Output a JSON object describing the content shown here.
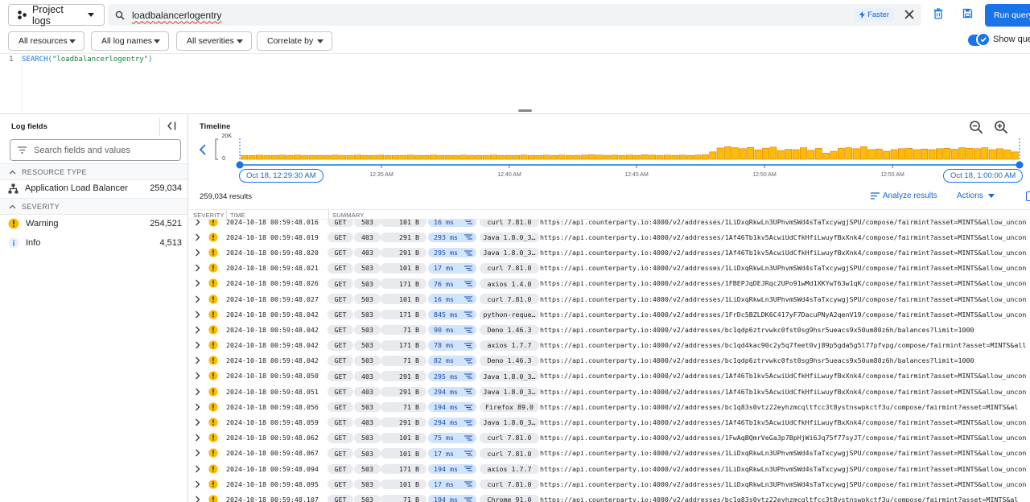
{
  "header": {
    "scope_label": "Project logs",
    "query_text": "loadbalancerlogentry",
    "faster_label": "Faster",
    "run_label": "Run query",
    "show_query_label": "Show query"
  },
  "filters": [
    {
      "label": "All resources"
    },
    {
      "label": "All log names"
    },
    {
      "label": "All severities"
    },
    {
      "label": "Correlate by"
    }
  ],
  "editor": {
    "line_number": "1",
    "fn": "SEARCH(",
    "arg": "\"loadbalancerlogentry\"",
    "close": ")"
  },
  "log_fields": {
    "title": "Log fields",
    "search_placeholder": "Search fields and values",
    "resource_type_header": "RESOURCE TYPE",
    "resource": {
      "name": "Application Load Balancer",
      "count": "259,034"
    },
    "severity_header": "SEVERITY",
    "severities": [
      {
        "name": "Warning",
        "count": "254,521"
      },
      {
        "name": "Info",
        "count": "4,513"
      }
    ]
  },
  "timeline": {
    "title": "Timeline",
    "y_max_label": "20K",
    "y_min_label": "0",
    "start_label": "Oct 18, 12:29:30 AM",
    "end_label": "Oct 18, 1:00:00 AM",
    "ticks": [
      "12:35 AM",
      "12:40 AM",
      "12:45 AM",
      "12:50 AM",
      "12:55 AM"
    ],
    "bars": [
      1.2,
      1.2,
      1.3,
      1.2,
      1.2,
      1.3,
      1.2,
      1.3,
      1.2,
      1.2,
      1.2,
      1.2,
      1.3,
      1.2,
      1.2,
      1.3,
      1.2,
      1.2,
      1.3,
      1.2,
      1.2,
      1.2,
      1.3,
      1.2,
      1.2,
      1.3,
      1.2,
      1.2,
      1.2,
      1.3,
      1.2,
      1.2,
      1.2,
      1.3,
      1.2,
      1.2,
      1.2,
      1.3,
      1.2,
      1.2,
      1.3,
      1.2,
      1.3,
      1.2,
      1.2,
      1.3,
      1.4,
      1.3,
      1.2,
      1.3,
      1.2,
      1.3,
      1.2,
      1.4,
      1.3,
      1.2,
      1.3,
      1.2,
      1.3,
      1.2,
      1.3,
      1.4,
      2.3,
      3.5,
      3.9,
      3.6,
      3.3,
      3.7,
      2.9,
      3.4,
      3.8,
      2.7,
      3.1,
      3.0,
      3.6,
      2.8,
      3.4,
      1.9,
      2.5,
      3.4,
      3.6,
      3.3,
      3.9,
      3.0,
      3.2,
      2.5,
      3.0,
      3.3,
      3.4,
      3.0,
      3.2,
      3.0,
      3.3,
      3.4,
      3.1,
      3.6,
      3.4,
      3.3,
      3.6,
      3.0,
      3.3,
      2.9,
      2.3
    ]
  },
  "results_count": "259,034 results",
  "analyze_label": "Analyze results",
  "actions_label": "Actions",
  "columns": {
    "severity": "SEVERITY",
    "time": "TIME",
    "summary": "SUMMARY"
  },
  "colors": {
    "accent": "#1a73e8",
    "warning": "#fbbc04",
    "bar_fill": "#fbbc04",
    "bar_stroke": "#e37400"
  },
  "rows": [
    {
      "time": "2024-10-18 00:59:48.016",
      "method": "GET",
      "status": "503",
      "size": "101 B",
      "latency": "16 ms",
      "agent": "curl 7.81.0",
      "url": "https://api.counterparty.io:4000/v2/addresses/1LiDxqRkwLn3UPhvmSWd4sTaTxcywgjSPU/compose/fairmint?asset=MINTS&allow_uncon"
    },
    {
      "time": "2024-10-18 00:59:48.019",
      "method": "GET",
      "status": "403",
      "size": "291 B",
      "latency": "293 ms",
      "agent": "Java 1.8.0_3…",
      "url": "https://api.counterparty.io:4000/v2/addresses/1Af46Tb1kv5AcwiUdCfkHfiLwuyfBxXnk4/compose/fairmint?asset=MINTS&allow_uncon"
    },
    {
      "time": "2024-10-18 00:59:48.020",
      "method": "GET",
      "status": "403",
      "size": "291 B",
      "latency": "295 ms",
      "agent": "Java 1.8.0_3…",
      "url": "https://api.counterparty.io:4000/v2/addresses/1Af46Tb1kv5AcwiUdCfkHfiLwuyfBxXnk4/compose/fairmint?asset=MINTS&allow_uncon"
    },
    {
      "time": "2024-10-18 00:59:48.021",
      "method": "GET",
      "status": "503",
      "size": "101 B",
      "latency": "17 ms",
      "agent": "curl 7.81.0",
      "url": "https://api.counterparty.io:4000/v2/addresses/1LiDxqRkwLn3UPhvmSWd4sTaTxcywgjSPU/compose/fairmint?asset=MINTS&allow_uncon"
    },
    {
      "time": "2024-10-18 00:59:48.026",
      "method": "GET",
      "status": "503",
      "size": "171 B",
      "latency": "76 ms",
      "agent": "axios 1.4.0",
      "url": "https://api.counterparty.io:4000/v2/addresses/1FBEPJqDEJRqc2UPo91wMd1XKYwT63w1qK/compose/fairmint?asset=MINTS&allow_uncon"
    },
    {
      "time": "2024-10-18 00:59:48.027",
      "method": "GET",
      "status": "503",
      "size": "101 B",
      "latency": "16 ms",
      "agent": "curl 7.81.0",
      "url": "https://api.counterparty.io:4000/v2/addresses/1LiDxqRkwLn3UPhvmSWd4sTaTxcywgjSPU/compose/fairmint?asset=MINTS&allow_uncon"
    },
    {
      "time": "2024-10-18 00:59:48.042",
      "method": "GET",
      "status": "503",
      "size": "171 B",
      "latency": "845 ms",
      "agent": "python-reque…",
      "url": "https://api.counterparty.io:4000/v2/addresses/1FrDc5BZLDK6C417yF7DacuPNyA2qenV19/compose/fairmint?asset=MINTS&allow_uncon"
    },
    {
      "time": "2024-10-18 00:59:48.042",
      "method": "GET",
      "status": "503",
      "size": "71 B",
      "latency": "90 ms",
      "agent": "Deno 1.46.3",
      "url": "https://api.counterparty.io:4000/v2/addresses/bc1qdp6ztrvwkc0fst0sg9hsr5ueacs9x50um80z6h/balances?limit=1000"
    },
    {
      "time": "2024-10-18 00:59:48.042",
      "method": "GET",
      "status": "503",
      "size": "171 B",
      "latency": "78 ms",
      "agent": "axios 1.7.7",
      "url": "https://api.counterparty.io:4000/v2/addresses/bc1qd4kac90c2y5q7feet0vj89p5gda5g5l77pfvpg/compose/fairmint?asset=MINTS&all"
    },
    {
      "time": "2024-10-18 00:59:48.042",
      "method": "GET",
      "status": "503",
      "size": "71 B",
      "latency": "82 ms",
      "agent": "Deno 1.46.3",
      "url": "https://api.counterparty.io:4000/v2/addresses/bc1qdp6ztrvwkc0fst0sg9hsr5ueacs9x50um80z6h/balances?limit=1000"
    },
    {
      "time": "2024-10-18 00:59:48.050",
      "method": "GET",
      "status": "403",
      "size": "291 B",
      "latency": "295 ms",
      "agent": "Java 1.8.0_3…",
      "url": "https://api.counterparty.io:4000/v2/addresses/1Af46Tb1kv5AcwiUdCfkHfiLwuyfBxXnk4/compose/fairmint?asset=MINTS&allow_uncon"
    },
    {
      "time": "2024-10-18 00:59:48.051",
      "method": "GET",
      "status": "403",
      "size": "291 B",
      "latency": "294 ms",
      "agent": "Java 1.8.0_3…",
      "url": "https://api.counterparty.io:4000/v2/addresses/1Af46Tb1kv5AcwiUdCfkHfiLwuyfBxXnk4/compose/fairmint?asset=MINTS&allow_uncon"
    },
    {
      "time": "2024-10-18 00:59:48.056",
      "method": "GET",
      "status": "503",
      "size": "71 B",
      "latency": "194 ms",
      "agent": "Firefox 89.0",
      "url": "https://api.counterparty.io:4000/v2/addresses/bc1q83s0vtz22eyhzmcqltfcc3t8ystnswpkctf3u/compose/fairmint?asset=MINTS&al"
    },
    {
      "time": "2024-10-18 00:59:48.059",
      "method": "GET",
      "status": "403",
      "size": "291 B",
      "latency": "294 ms",
      "agent": "Java 1.8.0_3…",
      "url": "https://api.counterparty.io:4000/v2/addresses/1Af46Tb1kv5AcwiUdCfkHfiLwuyfBxXnk4/compose/fairmint?asset=MINTS&allow_uncon"
    },
    {
      "time": "2024-10-18 00:59:48.062",
      "method": "GET",
      "status": "503",
      "size": "101 B",
      "latency": "75 ms",
      "agent": "curl 7.81.0",
      "url": "https://api.counterparty.io:4000/v2/addresses/1FwAqBQmrVeGa3p7BpHjWi6Jq75f77syJT/compose/fairmint?asset=MINTS&allow_uncon"
    },
    {
      "time": "2024-10-18 00:59:48.067",
      "method": "GET",
      "status": "503",
      "size": "101 B",
      "latency": "17 ms",
      "agent": "curl 7.81.0",
      "url": "https://api.counterparty.io:4000/v2/addresses/1LiDxqRkwLn3UPhvmSWd4sTaTxcywgjSPU/compose/fairmint?asset=MINTS&allow_uncon"
    },
    {
      "time": "2024-10-18 00:59:48.094",
      "method": "GET",
      "status": "503",
      "size": "171 B",
      "latency": "194 ms",
      "agent": "axios 1.7.7",
      "url": "https://api.counterparty.io:4000/v2/addresses/1LiDxqRkwLn3UPhvmSWd4sTaTxcywgjSPU/compose/fairmint?asset=MINTS&allow_uncon"
    },
    {
      "time": "2024-10-18 00:59:48.095",
      "method": "GET",
      "status": "503",
      "size": "101 B",
      "latency": "17 ms",
      "agent": "curl 7.81.0",
      "url": "https://api.counterparty.io:4000/v2/addresses/1LiDxqRkwLn3UPhvmSWd4sTaTxcywgjSPU/compose/fairmint?asset=MINTS&allow_uncon"
    },
    {
      "time": "2024-10-18 00:59:48.107",
      "method": "GET",
      "status": "503",
      "size": "71 B",
      "latency": "194 ms",
      "agent": "Chrome 91.0",
      "url": "https://api.counterparty.io:4000/v2/addresses/bc1q83s0vtz22eyhzmcqltfcc3t8ystnswpkctf3u/compose/fairmint?asset=MINTS&al"
    }
  ]
}
